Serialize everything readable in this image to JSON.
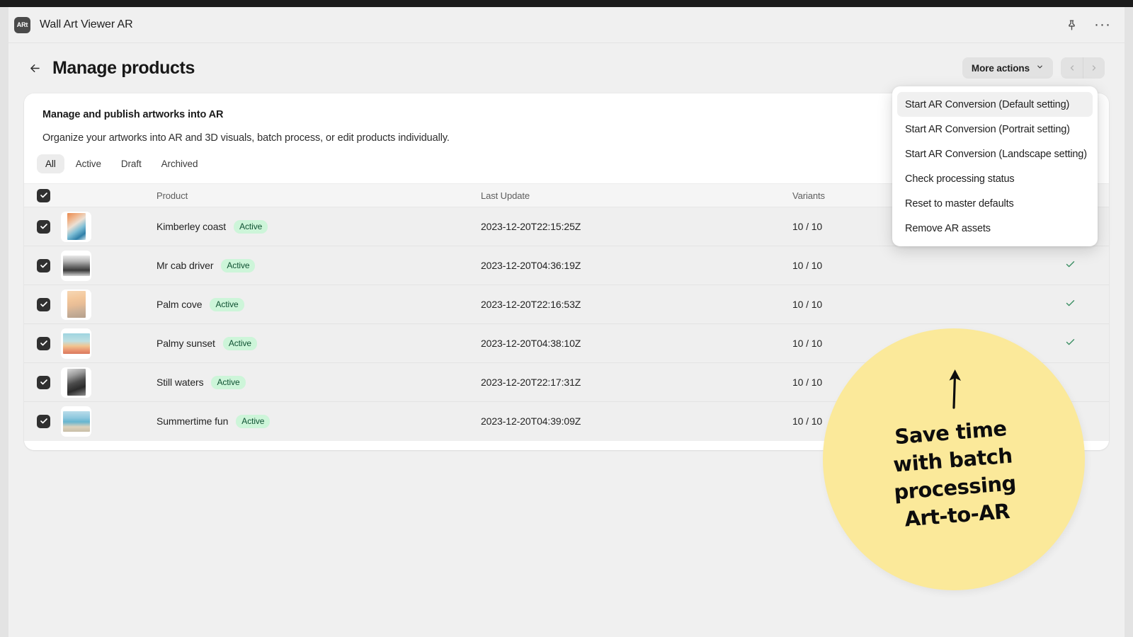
{
  "app": {
    "badge_text": "ARt",
    "title": "Wall Art Viewer AR",
    "pin_icon": "pin-icon",
    "overflow_icon": "ellipsis-icon"
  },
  "page": {
    "back_icon": "arrow-left-icon",
    "title": "Manage products",
    "more_actions_label": "More actions",
    "more_actions_chevron": "chevron-down-icon",
    "pager_prev": "chevron-left-icon",
    "pager_next": "chevron-right-icon"
  },
  "card": {
    "heading": "Manage and publish artworks into AR",
    "subtitle": "Organize your artworks into AR and 3D visuals, batch process, or edit products individually.",
    "tabs": [
      {
        "label": "All",
        "active": true
      },
      {
        "label": "Active",
        "active": false
      },
      {
        "label": "Draft",
        "active": false
      },
      {
        "label": "Archived",
        "active": false
      }
    ],
    "columns": {
      "select": "",
      "thumbnail": "",
      "product": "Product",
      "last_update": "Last Update",
      "variants": "Variants",
      "status": ""
    },
    "rows": [
      {
        "selected": true,
        "name": "Kimberley coast",
        "badge": "Active",
        "last_update": "2023-12-20T22:15:25Z",
        "variants": "10 / 10",
        "converted": false,
        "thumb": "artwork-kimberley-coast"
      },
      {
        "selected": true,
        "name": "Mr cab driver",
        "badge": "Active",
        "last_update": "2023-12-20T04:36:19Z",
        "variants": "10 / 10",
        "converted": true,
        "thumb": "artwork-mr-cab-driver"
      },
      {
        "selected": true,
        "name": "Palm cove",
        "badge": "Active",
        "last_update": "2023-12-20T22:16:53Z",
        "variants": "10 / 10",
        "converted": true,
        "thumb": "artwork-palm-cove"
      },
      {
        "selected": true,
        "name": "Palmy sunset",
        "badge": "Active",
        "last_update": "2023-12-20T04:38:10Z",
        "variants": "10 / 10",
        "converted": true,
        "thumb": "artwork-palmy-sunset"
      },
      {
        "selected": true,
        "name": "Still waters",
        "badge": "Active",
        "last_update": "2023-12-20T22:17:31Z",
        "variants": "10 / 10",
        "converted": false,
        "thumb": "artwork-still-waters"
      },
      {
        "selected": true,
        "name": "Summertime fun",
        "badge": "Active",
        "last_update": "2023-12-20T04:39:09Z",
        "variants": "10 / 10",
        "converted": false,
        "thumb": "artwork-summertime-fun"
      }
    ]
  },
  "more_actions_menu": {
    "items": [
      {
        "label": "Start AR Conversion (Default setting)",
        "highlighted": true
      },
      {
        "label": "Start AR Conversion (Portrait setting)",
        "highlighted": false
      },
      {
        "label": "Start AR Conversion (Landscape setting)",
        "highlighted": false
      },
      {
        "label": "Check processing status",
        "highlighted": false
      },
      {
        "label": "Reset to master defaults",
        "highlighted": false
      },
      {
        "label": "Remove AR assets",
        "highlighted": false
      }
    ]
  },
  "promo": {
    "arrow_icon": "arrow-up-icon",
    "line1": "Save time",
    "line2": "with batch",
    "line3": "processing",
    "line4": "Art-to-AR"
  },
  "colors": {
    "accent_yellow": "#fbe99a",
    "badge_green_bg": "#cdf5d9",
    "badge_green_text": "#0f5132",
    "checkbox_dark": "#303030",
    "check_green": "#3b8f63",
    "page_bg": "#f0f0f0",
    "card_bg": "#ffffff",
    "row_bg": "#efefef"
  }
}
